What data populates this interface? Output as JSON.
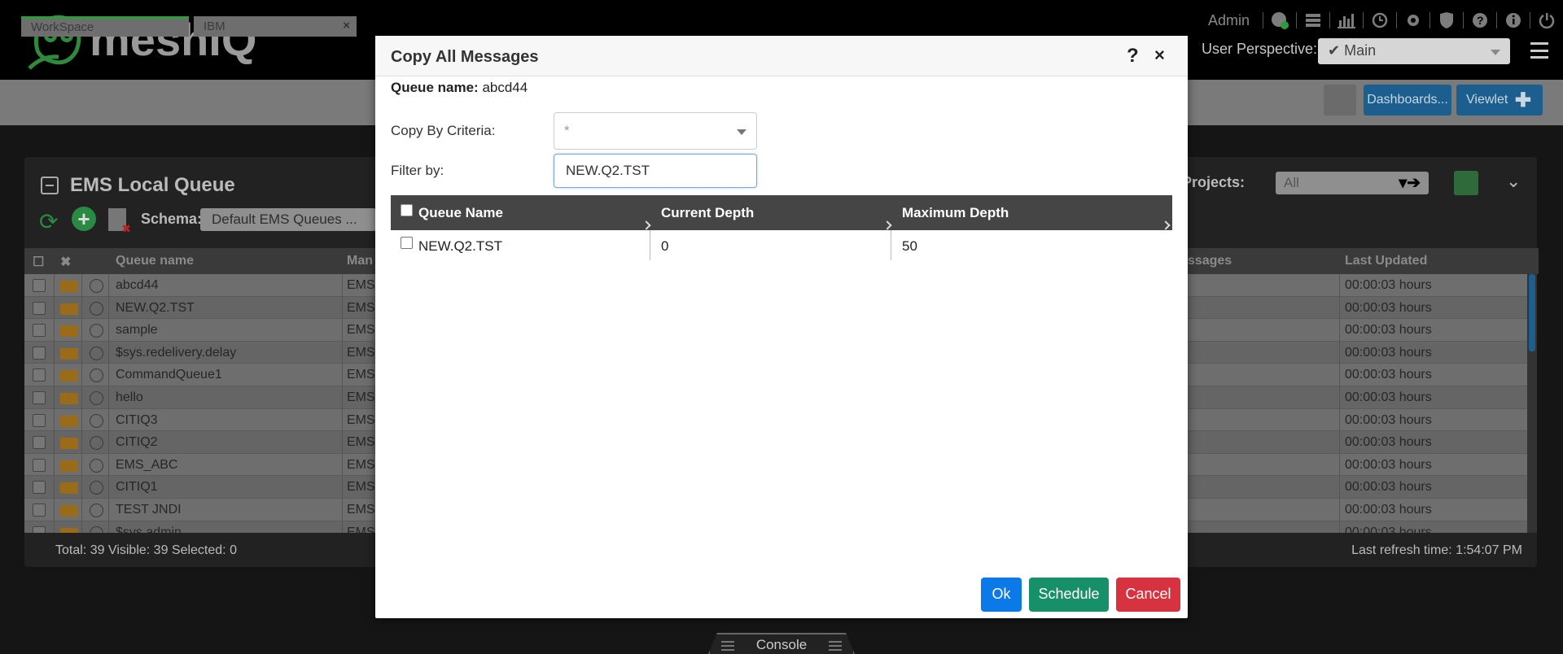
{
  "header": {
    "brand": "meshIQ",
    "user": "Admin",
    "perspective_label": "User Perspective:",
    "perspective_value": "Main",
    "check": "✔",
    "icons": [
      "globe-icon",
      "server-icon",
      "chart-icon",
      "clock-icon",
      "gear-icon",
      "shield-icon",
      "help-icon",
      "info-icon",
      "power-icon"
    ]
  },
  "tabs": [
    {
      "label": "WorkSpace"
    },
    {
      "label": "IBM",
      "close": "×"
    }
  ],
  "toolbar": {
    "dashboards": "Dashboards...",
    "viewlet": "Viewlet",
    "plus": "✚"
  },
  "panel": {
    "title": "EMS Local Queue",
    "schema_label": "Schema:",
    "schema_value": "Default EMS Queues ...",
    "projects_label": "Projects:",
    "projects_value": "All",
    "columns": [
      "Queue name",
      "Man",
      "essages",
      "Last Updated"
    ],
    "rows": [
      {
        "name": "abcd44",
        "mgr": "EMS-",
        "updated": "00:00:03 hours"
      },
      {
        "name": "NEW.Q2.TST",
        "mgr": "EMS-",
        "updated": "00:00:03 hours"
      },
      {
        "name": "sample",
        "mgr": "EMS-",
        "updated": "00:00:03 hours"
      },
      {
        "name": "$sys.redelivery.delay",
        "mgr": "EMS-",
        "updated": "00:00:03 hours"
      },
      {
        "name": "CommandQueue1",
        "mgr": "EMS-",
        "updated": "00:00:03 hours"
      },
      {
        "name": "hello",
        "mgr": "EMS-",
        "updated": "00:00:03 hours"
      },
      {
        "name": "CITIQ3",
        "mgr": "EMS-",
        "updated": "00:00:03 hours"
      },
      {
        "name": "CITIQ2",
        "mgr": "EMS-",
        "updated": "00:00:03 hours"
      },
      {
        "name": "EMS_ABC",
        "mgr": "EMS-",
        "updated": "00:00:03 hours"
      },
      {
        "name": "CITIQ1",
        "mgr": "EMS-",
        "updated": "00:00:03 hours"
      },
      {
        "name": "TEST JNDI",
        "mgr": "EMS-",
        "updated": "00:00:03 hours"
      },
      {
        "name": "$sys.admin",
        "mgr": "EMS-",
        "updated": "00:00:03 hours"
      }
    ],
    "footer_left": "Total: 39 Visible: 39 Selected: 0",
    "footer_right": "Last refresh time: 1:54:07 PM"
  },
  "console": {
    "label": "Console"
  },
  "modal": {
    "title": "Copy All Messages",
    "help": "?",
    "close": "×",
    "queue_name_label": "Queue name:",
    "queue_name_value": "abcd44",
    "criteria_label": "Copy By Criteria:",
    "criteria_value": "*",
    "filter_label": "Filter by:",
    "filter_value": "NEW.Q2.TST",
    "table": {
      "headers": [
        "Queue Name",
        "Current Depth",
        "Maximum Depth"
      ],
      "rows": [
        {
          "name": "NEW.Q2.TST",
          "current": "0",
          "max": "50"
        }
      ]
    },
    "buttons": {
      "ok": "Ok",
      "schedule": "Schedule",
      "cancel": "Cancel"
    }
  },
  "colors": {
    "ok": "#0b79e8",
    "schedule": "#17906a",
    "cancel": "#d6323f",
    "brand_green": "#2f9b3d"
  }
}
